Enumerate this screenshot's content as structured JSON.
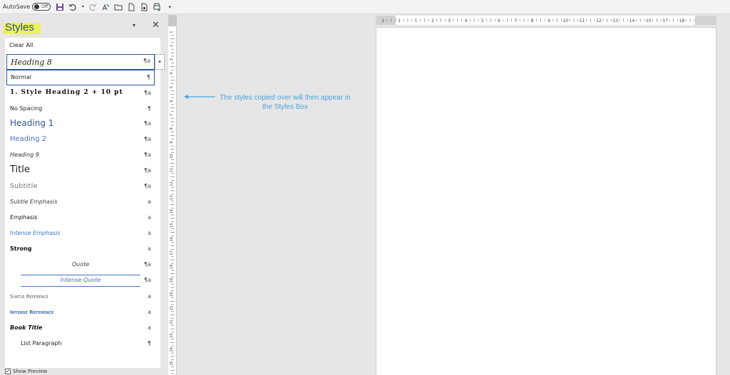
{
  "qat": {
    "autosave_label": "AutoSave",
    "toggle_label": "Off",
    "more_label": "▾"
  },
  "styles_pane": {
    "title": "Styles",
    "menu_glyph": "▾",
    "close_glyph": "✕",
    "clear_all": "Clear All",
    "selected_style": "Heading 8",
    "selected_mark": "¶a",
    "dropdown_glyph": "▾",
    "items": [
      {
        "label": "Normal",
        "mark": "¶"
      },
      {
        "label": "1.  Style Heading 2 + 10 pt",
        "mark": "¶a"
      },
      {
        "label": "No Spacing",
        "mark": "¶"
      },
      {
        "label": "Heading 1",
        "mark": "¶a"
      },
      {
        "label": "Heading 2",
        "mark": "¶a"
      },
      {
        "label": "Heading 9",
        "mark": "¶a"
      },
      {
        "label": "Title",
        "mark": "¶a"
      },
      {
        "label": "Subtitle",
        "mark": "¶a"
      },
      {
        "label": "Subtle Emphasis",
        "mark": "a"
      },
      {
        "label": "Emphasis",
        "mark": "a"
      },
      {
        "label": "Intense Emphasis",
        "mark": "a"
      },
      {
        "label": "Strong",
        "mark": "a"
      },
      {
        "label": "Quote",
        "mark": "¶a"
      },
      {
        "label": "Intense Quote",
        "mark": "¶a"
      },
      {
        "label": "Subtle Reference",
        "mark": "a"
      },
      {
        "label": "Intense Reference",
        "mark": "a"
      },
      {
        "label": "Book Title",
        "mark": "a"
      },
      {
        "label": "List Paragraph",
        "mark": "¶"
      }
    ],
    "show_preview_label": "Show Preview",
    "show_preview_checked": "✓"
  },
  "annotation": {
    "text": "The styles copied over will then appear in the Styles Box",
    "color": "#4aa3df"
  },
  "ruler": {
    "horizontal_labels": [
      "2",
      "1",
      "1",
      "2",
      "3",
      "4",
      "5",
      "6",
      "7",
      "8",
      "9",
      "10",
      "11",
      "12",
      "13",
      "14",
      "15",
      "17",
      "18"
    ],
    "vertical_labels": [
      "1",
      "2",
      "3",
      "4",
      "5",
      "6",
      "7",
      "8",
      "9",
      "10",
      "11",
      "12",
      "13",
      "14",
      "15",
      "16",
      "17",
      "18",
      "19",
      "20",
      "21",
      "22",
      "23",
      "24",
      "25"
    ]
  },
  "colors": {
    "accent": "#2b579a",
    "highlight": "#eef25a",
    "heading_blue": "#2f5597"
  }
}
